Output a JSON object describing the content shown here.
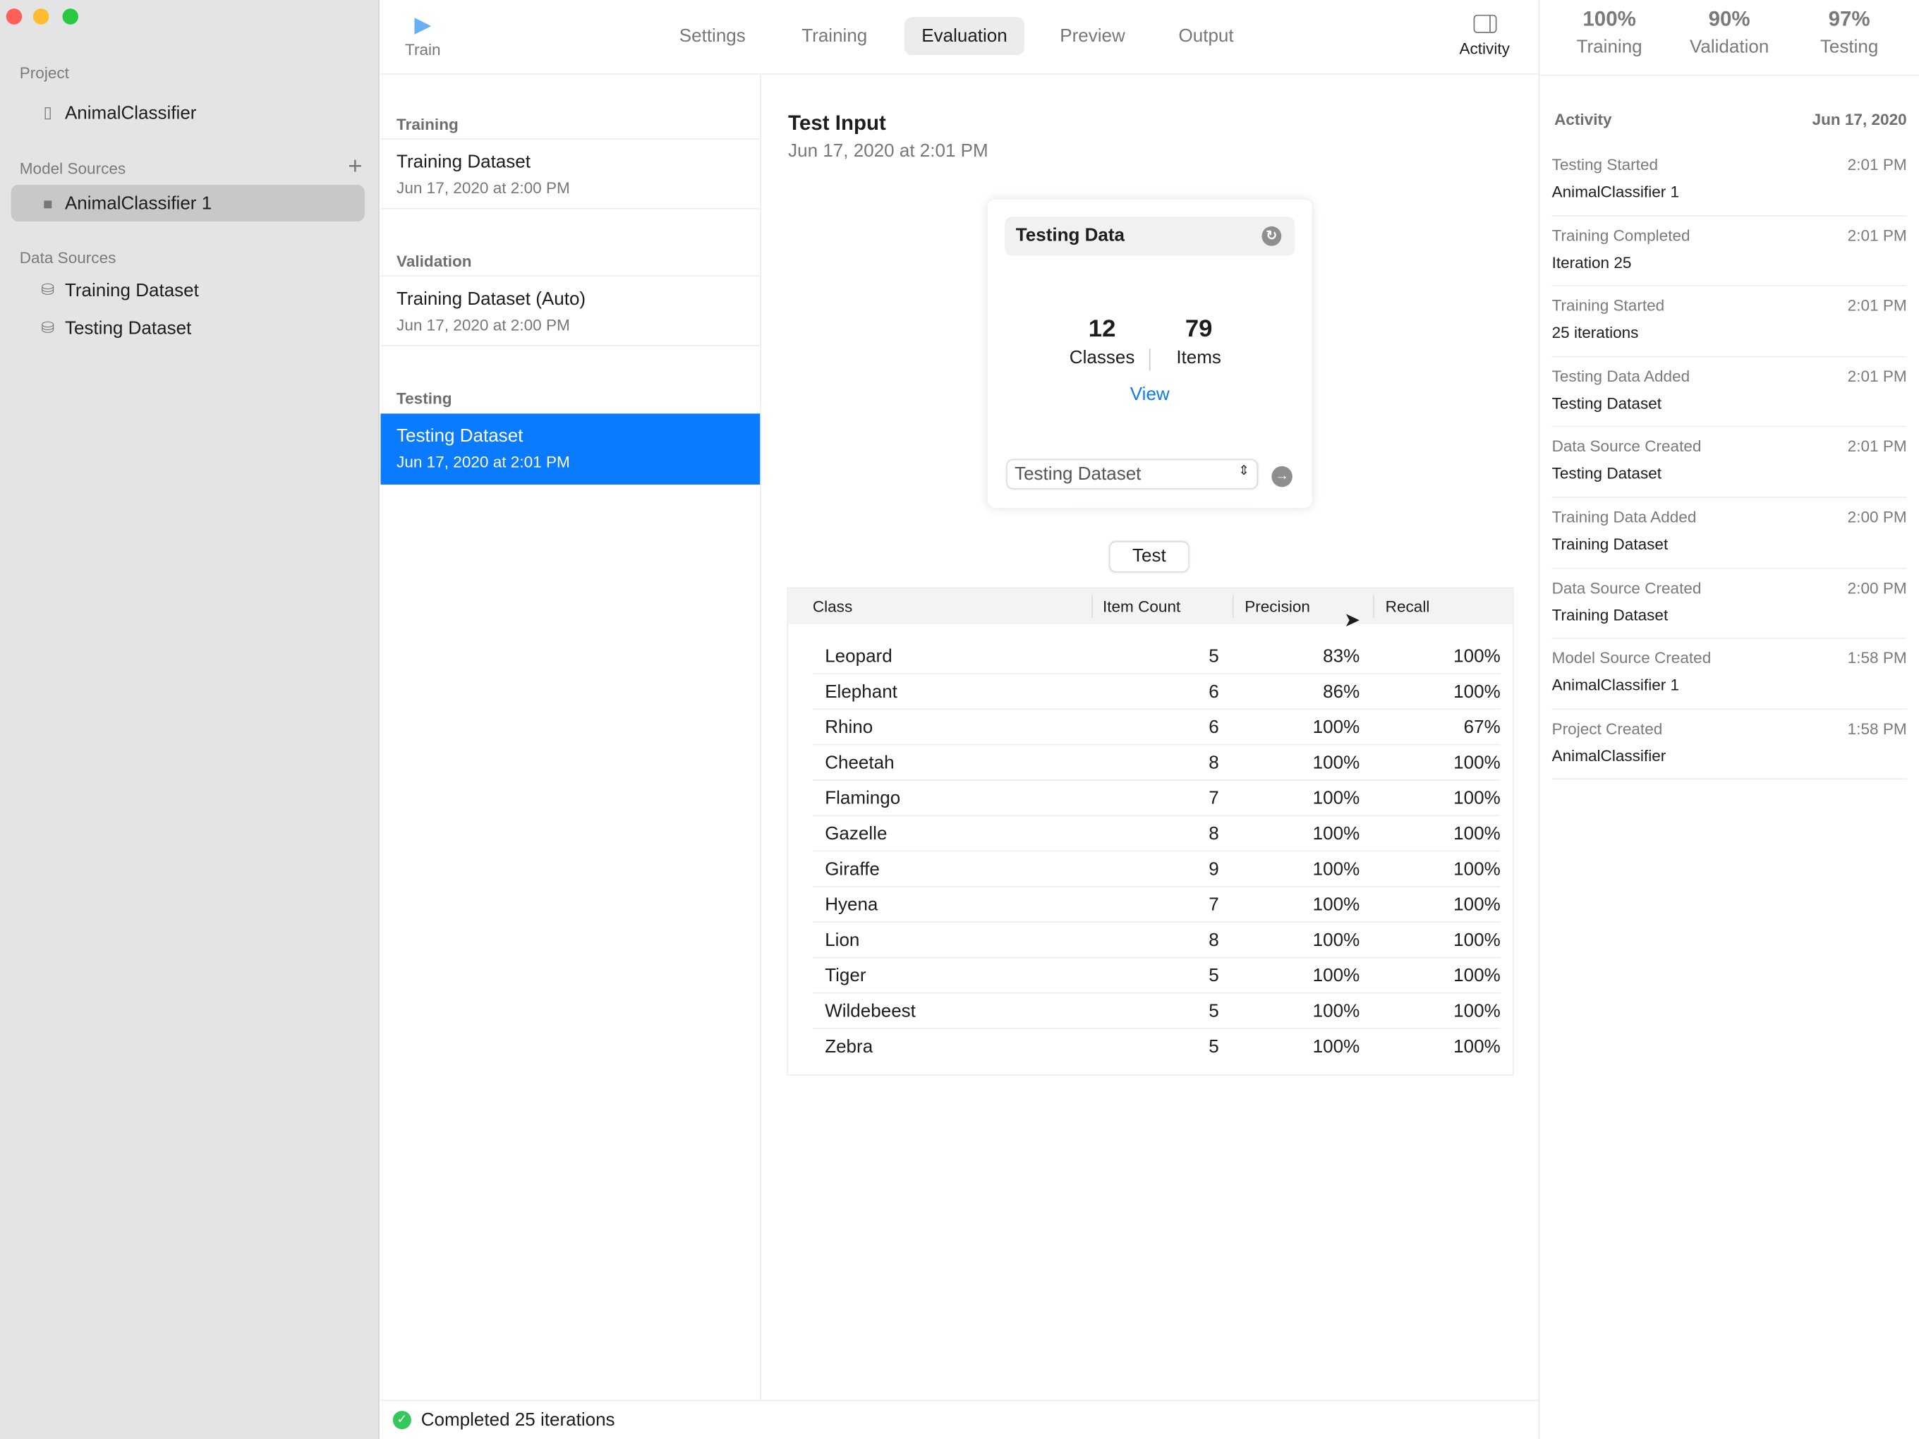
{
  "window": {
    "controls": [
      "close",
      "minimize",
      "zoom"
    ]
  },
  "sidebar": {
    "project_header": "Project",
    "project_item": "AnimalClassifier",
    "model_header": "Model Sources",
    "model_item": "AnimalClassifier 1",
    "data_header": "Data Sources",
    "data_items": [
      "Training Dataset",
      "Testing Dataset"
    ]
  },
  "toolbar": {
    "train_label": "Train",
    "tabs": [
      "Settings",
      "Training",
      "Evaluation",
      "Preview",
      "Output"
    ],
    "active_tab": "Evaluation",
    "activity_label": "Activity"
  },
  "metrics": [
    {
      "value": "100%",
      "label": "Training"
    },
    {
      "value": "90%",
      "label": "Validation"
    },
    {
      "value": "97%",
      "label": "Testing"
    }
  ],
  "sources": [
    {
      "header": "Training",
      "title": "Training Dataset",
      "date": "Jun 17, 2020 at 2:00 PM"
    },
    {
      "header": "Validation",
      "title": "Training Dataset (Auto)",
      "date": "Jun 17, 2020 at 2:00 PM"
    },
    {
      "header": "Testing",
      "title": "Testing Dataset",
      "date": "Jun 17, 2020 at 2:01 PM"
    }
  ],
  "main": {
    "title": "Test Input",
    "date": "Jun 17, 2020 at 2:01 PM",
    "card": {
      "title": "Testing Data",
      "classes_count": "12",
      "classes_label": "Classes",
      "items_count": "79",
      "items_label": "Items",
      "view_link": "View",
      "select_value": "Testing Dataset"
    },
    "test_button": "Test",
    "table": {
      "headers": [
        "Class",
        "Item Count",
        "Precision",
        "Recall"
      ],
      "rows": [
        [
          "Leopard",
          "5",
          "83%",
          "100%"
        ],
        [
          "Elephant",
          "6",
          "86%",
          "100%"
        ],
        [
          "Rhino",
          "6",
          "100%",
          "67%"
        ],
        [
          "Cheetah",
          "8",
          "100%",
          "100%"
        ],
        [
          "Flamingo",
          "7",
          "100%",
          "100%"
        ],
        [
          "Gazelle",
          "8",
          "100%",
          "100%"
        ],
        [
          "Giraffe",
          "9",
          "100%",
          "100%"
        ],
        [
          "Hyena",
          "7",
          "100%",
          "100%"
        ],
        [
          "Lion",
          "8",
          "100%",
          "100%"
        ],
        [
          "Tiger",
          "5",
          "100%",
          "100%"
        ],
        [
          "Wildebeest",
          "5",
          "100%",
          "100%"
        ],
        [
          "Zebra",
          "5",
          "100%",
          "100%"
        ]
      ]
    }
  },
  "status": {
    "text": "Completed 25 iterations",
    "color": "#34c759"
  },
  "activity": {
    "header": "Activity",
    "date": "Jun 17, 2020",
    "items": [
      [
        "Testing Started",
        "2:01 PM",
        "AnimalClassifier 1"
      ],
      [
        "Training Completed",
        "2:01 PM",
        "Iteration 25"
      ],
      [
        "Training Started",
        "2:01 PM",
        "25 iterations"
      ],
      [
        "Testing Data Added",
        "2:01 PM",
        "Testing Dataset"
      ],
      [
        "Data Source Created",
        "2:01 PM",
        "Testing Dataset"
      ],
      [
        "Training Data Added",
        "2:00 PM",
        "Training Dataset"
      ],
      [
        "Data Source Created",
        "2:00 PM",
        "Training Dataset"
      ],
      [
        "Model Source Created",
        "1:58 PM",
        "AnimalClassifier 1"
      ],
      [
        "Project Created",
        "1:58 PM",
        "AnimalClassifier"
      ]
    ]
  },
  "colors": {
    "accent": "#0a7aff",
    "sidebar": "#e4e4e4"
  }
}
